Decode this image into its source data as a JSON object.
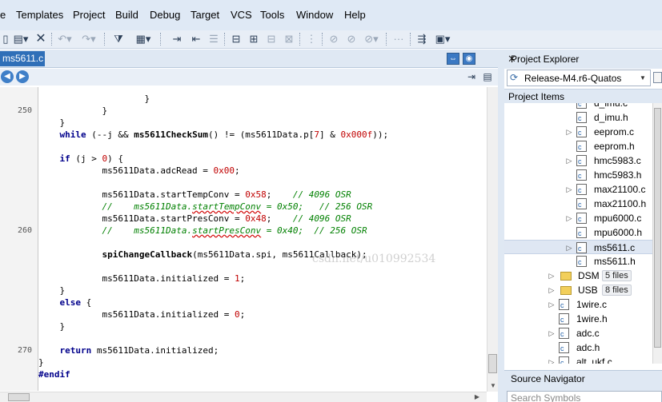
{
  "menu": [
    "e",
    "Templates",
    "Project",
    "Build",
    "Debug",
    "Target",
    "VCS",
    "Tools",
    "Window",
    "Help"
  ],
  "toolbar_icons": [
    "new-file-icon",
    "paste-icon",
    "close-x-icon",
    "undo-icon",
    "redo-icon",
    "filter-icon",
    "build-icon",
    "indent-icon",
    "bookmark-icon"
  ],
  "editor": {
    "tab_label": "ms5611.c",
    "line_numbers": [
      {
        "label": "250",
        "row": 1
      },
      {
        "label": "260",
        "row": 11
      },
      {
        "label": "270",
        "row": 21
      }
    ],
    "code_lines": [
      {
        "parts": [
          {
            "t": "                    }",
            "c": ""
          }
        ]
      },
      {
        "parts": [
          {
            "t": "            }",
            "c": ""
          }
        ]
      },
      {
        "parts": [
          {
            "t": "    }",
            "c": ""
          }
        ]
      },
      {
        "parts": [
          {
            "t": "    ",
            "c": ""
          },
          {
            "t": "while",
            "c": "kw"
          },
          {
            "t": " (--j && ",
            "c": ""
          },
          {
            "t": "ms5611CheckSum",
            "c": "fn"
          },
          {
            "t": "() != (ms5611Data.p[",
            "c": ""
          },
          {
            "t": "7",
            "c": "num"
          },
          {
            "t": "] & ",
            "c": ""
          },
          {
            "t": "0x000f",
            "c": "num"
          },
          {
            "t": "));",
            "c": ""
          }
        ]
      },
      {
        "parts": [
          {
            "t": "",
            "c": ""
          }
        ]
      },
      {
        "parts": [
          {
            "t": "    ",
            "c": ""
          },
          {
            "t": "if",
            "c": "kw"
          },
          {
            "t": " (j > ",
            "c": ""
          },
          {
            "t": "0",
            "c": "num"
          },
          {
            "t": ") {",
            "c": ""
          }
        ]
      },
      {
        "parts": [
          {
            "t": "            ms5611Data.adcRead = ",
            "c": ""
          },
          {
            "t": "0x00",
            "c": "num"
          },
          {
            "t": ";",
            "c": ""
          }
        ]
      },
      {
        "parts": [
          {
            "t": "",
            "c": ""
          }
        ]
      },
      {
        "parts": [
          {
            "t": "            ms5611Data.startTempConv = ",
            "c": ""
          },
          {
            "t": "0x58",
            "c": "num"
          },
          {
            "t": ";    ",
            "c": ""
          },
          {
            "t": "// 4096 OSR",
            "c": "cm"
          }
        ]
      },
      {
        "parts": [
          {
            "t": "            ",
            "c": ""
          },
          {
            "t": "//    ms5611Data.",
            "c": "cm"
          },
          {
            "t": "startTempConv",
            "c": "cm sq"
          },
          {
            "t": " = 0x50;   // 256 OSR",
            "c": "cm"
          }
        ]
      },
      {
        "parts": [
          {
            "t": "            ms5611Data.startPresConv = ",
            "c": ""
          },
          {
            "t": "0x48",
            "c": "num"
          },
          {
            "t": ";    ",
            "c": ""
          },
          {
            "t": "// 4096 OSR",
            "c": "cm"
          }
        ]
      },
      {
        "parts": [
          {
            "t": "            ",
            "c": ""
          },
          {
            "t": "//    ms5611Data.",
            "c": "cm"
          },
          {
            "t": "startPresConv",
            "c": "cm sq"
          },
          {
            "t": " = 0x40;  // 256 OSR",
            "c": "cm"
          }
        ]
      },
      {
        "parts": [
          {
            "t": "",
            "c": ""
          }
        ]
      },
      {
        "parts": [
          {
            "t": "            ",
            "c": ""
          },
          {
            "t": "spiChangeCallback",
            "c": "fn"
          },
          {
            "t": "(ms5611Data.spi, ms5611Callback);",
            "c": ""
          }
        ]
      },
      {
        "parts": [
          {
            "t": "",
            "c": ""
          }
        ]
      },
      {
        "parts": [
          {
            "t": "            ms5611Data.initialized = ",
            "c": ""
          },
          {
            "t": "1",
            "c": "num"
          },
          {
            "t": ";",
            "c": ""
          }
        ]
      },
      {
        "parts": [
          {
            "t": "    }",
            "c": ""
          }
        ]
      },
      {
        "parts": [
          {
            "t": "    ",
            "c": ""
          },
          {
            "t": "else",
            "c": "kw"
          },
          {
            "t": " {",
            "c": ""
          }
        ]
      },
      {
        "parts": [
          {
            "t": "            ms5611Data.initialized = ",
            "c": ""
          },
          {
            "t": "0",
            "c": "num"
          },
          {
            "t": ";",
            "c": ""
          }
        ]
      },
      {
        "parts": [
          {
            "t": "    }",
            "c": ""
          }
        ]
      },
      {
        "parts": [
          {
            "t": "",
            "c": ""
          }
        ]
      },
      {
        "parts": [
          {
            "t": "    ",
            "c": ""
          },
          {
            "t": "return",
            "c": "kw"
          },
          {
            "t": " ms5611Data.initialized;",
            "c": ""
          }
        ]
      },
      {
        "parts": [
          {
            "t": "}",
            "c": ""
          }
        ]
      },
      {
        "parts": [
          {
            "t": "#endif",
            "c": "kw"
          }
        ]
      }
    ],
    "watermark": "csdn.net/u010992534"
  },
  "project_explorer": {
    "title": "Project Explorer",
    "config": "Release-M4.r6-Quatos",
    "items_header": "Project Items",
    "tree": [
      {
        "label": "d_imu.c",
        "type": "file",
        "indent": 2,
        "expander": false
      },
      {
        "label": "d_imu.h",
        "type": "file",
        "indent": 2,
        "expander": false
      },
      {
        "label": "eeprom.c",
        "type": "file",
        "indent": 2,
        "expander": true
      },
      {
        "label": "eeprom.h",
        "type": "file",
        "indent": 2,
        "expander": false
      },
      {
        "label": "hmc5983.c",
        "type": "file",
        "indent": 2,
        "expander": true
      },
      {
        "label": "hmc5983.h",
        "type": "file",
        "indent": 2,
        "expander": false
      },
      {
        "label": "max21100.c",
        "type": "file",
        "indent": 2,
        "expander": true
      },
      {
        "label": "max21100.h",
        "type": "file",
        "indent": 2,
        "expander": false
      },
      {
        "label": "mpu6000.c",
        "type": "file",
        "indent": 2,
        "expander": true
      },
      {
        "label": "mpu6000.h",
        "type": "file",
        "indent": 2,
        "expander": false
      },
      {
        "label": "ms5611.c",
        "type": "file",
        "indent": 2,
        "expander": true,
        "selected": true
      },
      {
        "label": "ms5611.h",
        "type": "file",
        "indent": 2,
        "expander": false
      },
      {
        "label": "DSM",
        "type": "folder",
        "indent": 1,
        "expander": true,
        "badge": "5 files"
      },
      {
        "label": "USB",
        "type": "folder",
        "indent": 1,
        "expander": true,
        "badge": "8 files"
      },
      {
        "label": "1wire.c",
        "type": "file",
        "indent": 0,
        "expander": true
      },
      {
        "label": "1wire.h",
        "type": "file",
        "indent": 0,
        "expander": false
      },
      {
        "label": "adc.c",
        "type": "file",
        "indent": 0,
        "expander": true
      },
      {
        "label": "adc.h",
        "type": "file",
        "indent": 0,
        "expander": false
      },
      {
        "label": "alt_ukf.c",
        "type": "file",
        "indent": 0,
        "expander": true
      }
    ]
  },
  "source_navigator": {
    "title": "Source Navigator",
    "search_placeholder": "Search Symbols"
  }
}
